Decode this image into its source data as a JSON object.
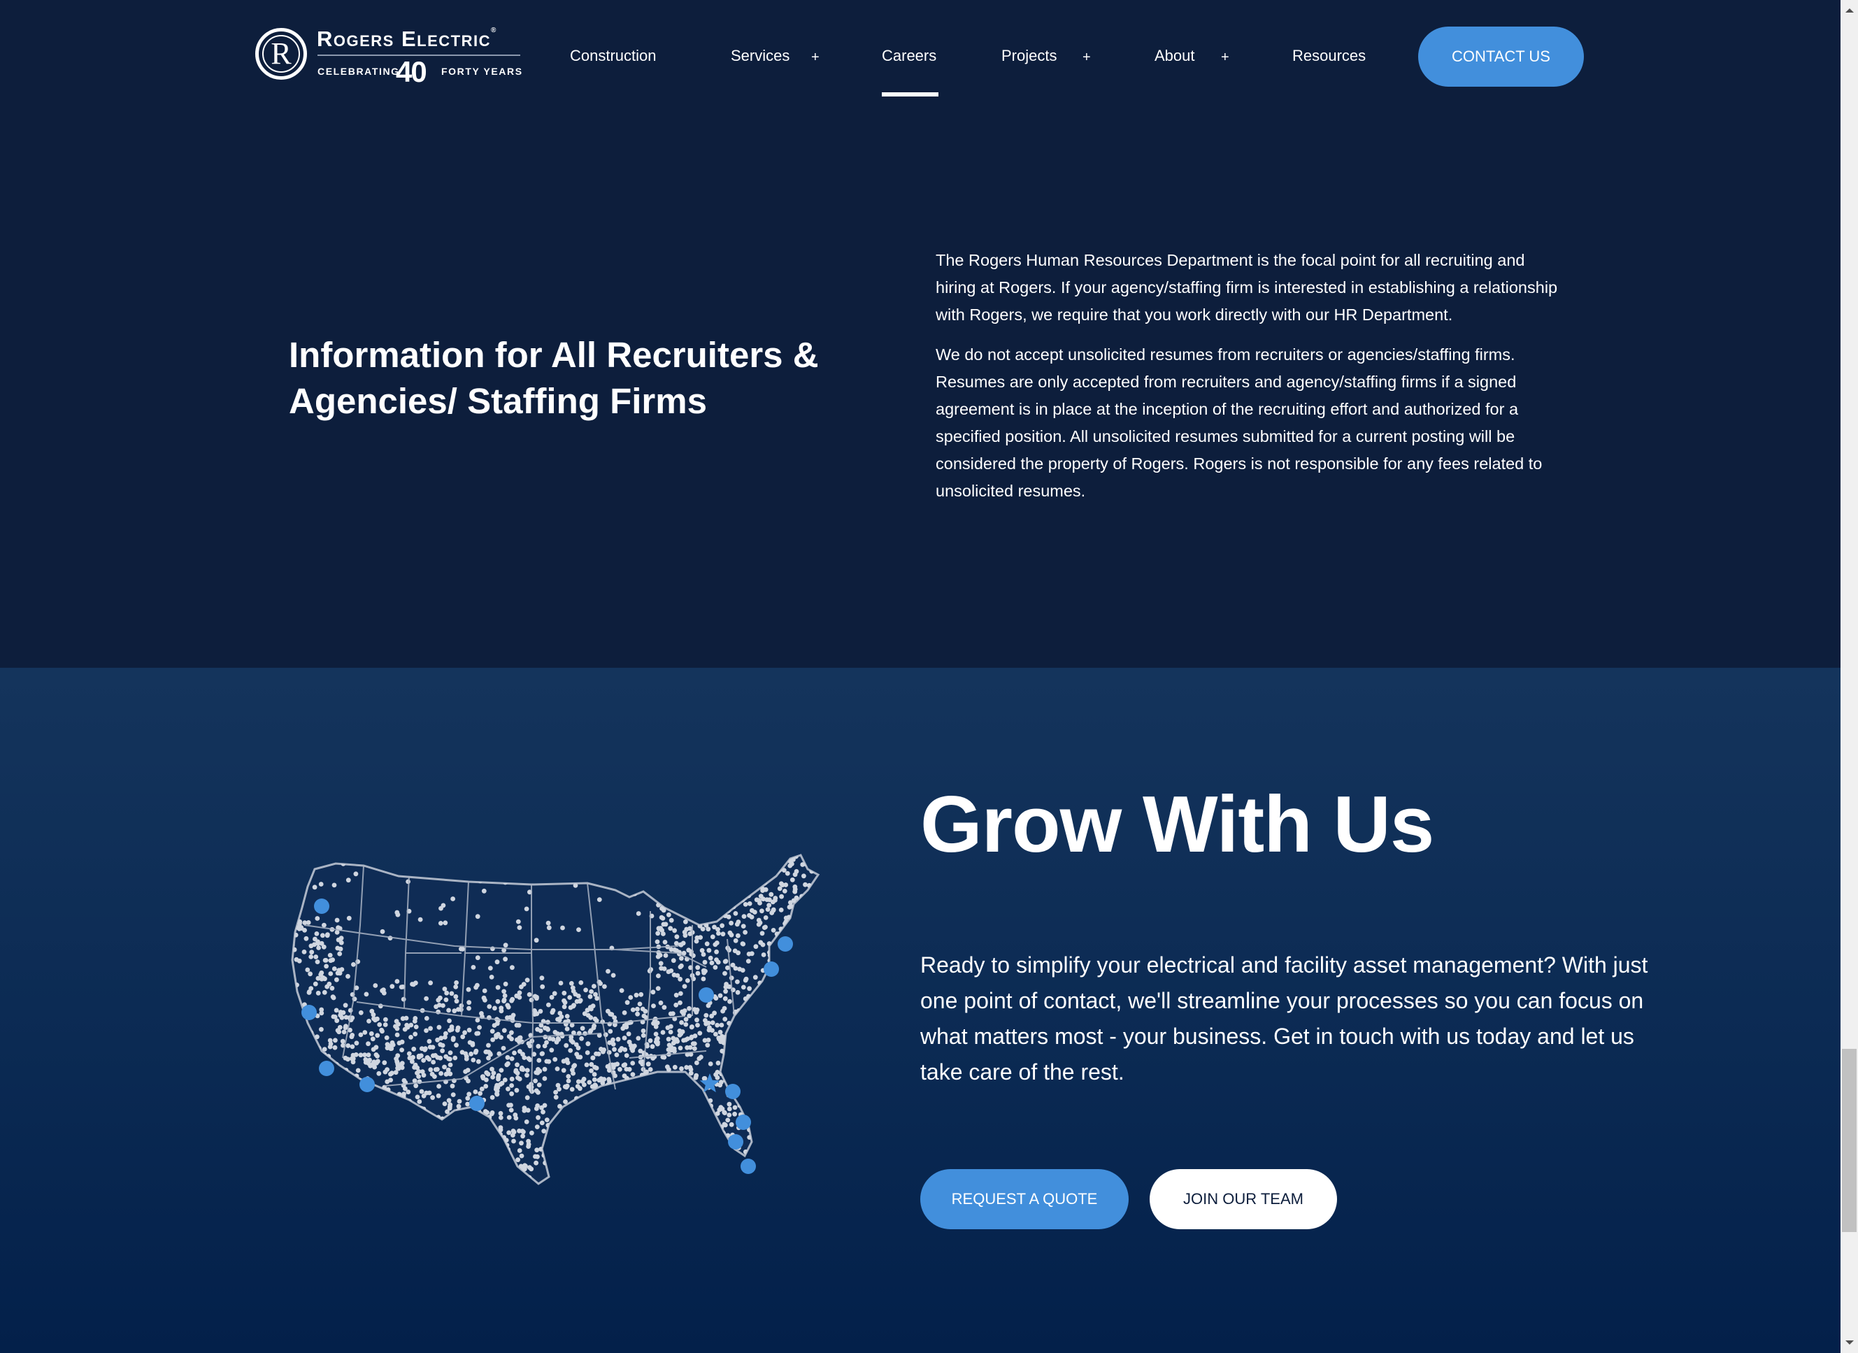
{
  "brand": {
    "name": "Rogers Electric",
    "registered_mark": "®",
    "monogram": "R",
    "tagline_left": "CELEBRATING",
    "tagline_number": "40",
    "tagline_right": "FORTY YEARS"
  },
  "nav": {
    "items": [
      {
        "label": "Construction",
        "has_submenu": false,
        "active": false
      },
      {
        "label": "Services",
        "has_submenu": true,
        "active": false
      },
      {
        "label": "Careers",
        "has_submenu": false,
        "active": true
      },
      {
        "label": "Projects",
        "has_submenu": true,
        "active": false
      },
      {
        "label": "About",
        "has_submenu": true,
        "active": false
      },
      {
        "label": "Resources",
        "has_submenu": false,
        "active": false
      }
    ],
    "submenu_glyph": "+",
    "contact_label": "CONTACT US"
  },
  "recruiters": {
    "heading": "Information for All Recruiters & Agencies/ Staffing Firms",
    "paragraphs": [
      "The Rogers Human Resources Department is the focal point for all recruiting and hiring at Rogers. If your agency/staffing firm is interested in establishing a relationship with Rogers, we require that you work directly with our HR Department.",
      "We do not accept unsolicited resumes from recruiters or agencies/staffing firms. Resumes are only accepted from recruiters and agency/staffing firms if a signed agreement is in place at the inception of the recruiting effort and authorized for a specified position. All unsolicited resumes submitted for a current posting will be considered the property of Rogers. Rogers is not responsible for any fees related to unsolicited resumes."
    ]
  },
  "grow": {
    "heading": "Grow With Us",
    "text": "Ready to simplify your electrical and facility asset management? With just one point of contact, we'll streamline your processes so you can focus on what matters most - your business. Get in touch with us today and let us take care of the rest.",
    "primary_button": "REQUEST A QUOTE",
    "secondary_button": "JOIN OUR TEAM",
    "map": {
      "description": "US service coverage map",
      "marker_count": 13,
      "headquarters_marker": "star"
    }
  },
  "colors": {
    "navy": "#0d1e3c",
    "section_blue": "#14345c",
    "accent_blue": "#428fdc",
    "map_fill": "#d0d6e0"
  }
}
